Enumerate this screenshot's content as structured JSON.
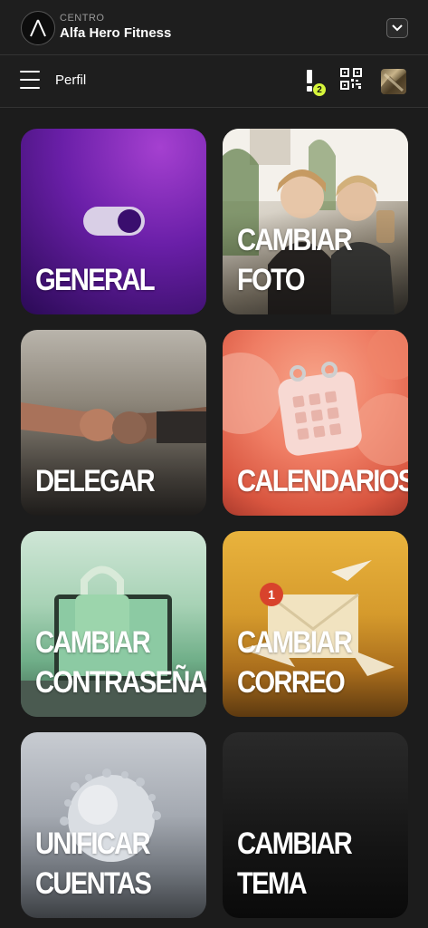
{
  "center": {
    "label": "CENTRO",
    "name": "Alfa Hero Fitness"
  },
  "header": {
    "title": "Perfil",
    "notification_count": "2"
  },
  "cards": [
    {
      "label": "GENERAL"
    },
    {
      "label": "CAMBIAR\nFOTO"
    },
    {
      "label": "DELEGAR"
    },
    {
      "label": "CALENDARIOS"
    },
    {
      "label": "CAMBIAR\nCONTRASEÑA"
    },
    {
      "label": "CAMBIAR\nCORREO"
    },
    {
      "label": "UNIFICAR\nCUENTAS"
    },
    {
      "label": "CAMBIAR\nTEMA"
    }
  ],
  "icons": {
    "logo": "alfa-logo-icon",
    "dropdown": "chevron-down-icon",
    "menu": "hamburger-menu-icon",
    "notifications": "alert-icon",
    "qr": "qr-code-icon"
  },
  "colors": {
    "background": "#1c1c1c",
    "badge": "#d6f53b"
  }
}
